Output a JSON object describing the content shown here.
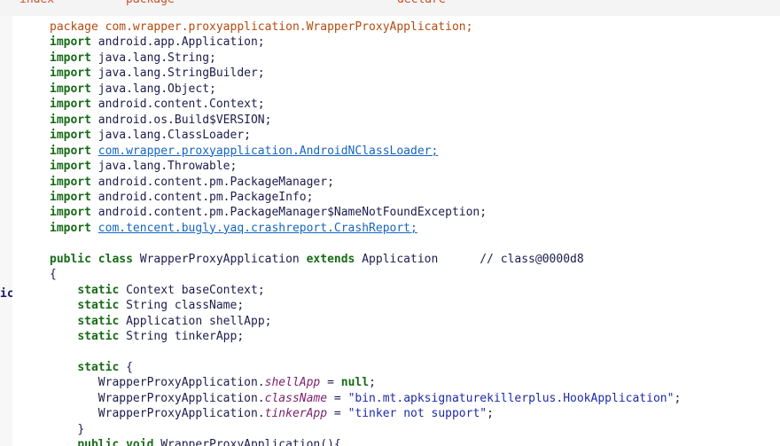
{
  "tabs": [
    "index",
    "package",
    "declare"
  ],
  "sidebar_mark": "ic",
  "lines": [
    {
      "indent": "",
      "parts": [
        {
          "t": "package ",
          "c": "pkg"
        },
        {
          "t": "com.wrapper.proxyapplication.WrapperProxyApplication;",
          "c": "pkg"
        }
      ]
    },
    {
      "indent": "",
      "parts": [
        {
          "t": "import",
          "c": "kw-g"
        },
        {
          "t": " android.app.Application;",
          "c": ""
        }
      ]
    },
    {
      "indent": "",
      "parts": [
        {
          "t": "import",
          "c": "kw-g"
        },
        {
          "t": " java.lang.String;",
          "c": ""
        }
      ]
    },
    {
      "indent": "",
      "parts": [
        {
          "t": "import",
          "c": "kw-g"
        },
        {
          "t": " java.lang.StringBuilder;",
          "c": ""
        }
      ]
    },
    {
      "indent": "",
      "parts": [
        {
          "t": "import",
          "c": "kw-g"
        },
        {
          "t": " java.lang.Object;",
          "c": ""
        }
      ]
    },
    {
      "indent": "",
      "parts": [
        {
          "t": "import",
          "c": "kw-g"
        },
        {
          "t": " android.content.Context;",
          "c": ""
        }
      ]
    },
    {
      "indent": "",
      "parts": [
        {
          "t": "import",
          "c": "kw-g"
        },
        {
          "t": " android.os.Build$VERSION;",
          "c": ""
        }
      ]
    },
    {
      "indent": "",
      "parts": [
        {
          "t": "import",
          "c": "kw-g"
        },
        {
          "t": " java.lang.ClassLoader;",
          "c": ""
        }
      ]
    },
    {
      "indent": "",
      "parts": [
        {
          "t": "import",
          "c": "kw-g"
        },
        {
          "t": " ",
          "c": ""
        },
        {
          "t": "com.wrapper.proxyapplication.AndroidNClassLoader;",
          "c": "link"
        }
      ]
    },
    {
      "indent": "",
      "parts": [
        {
          "t": "import",
          "c": "kw-g"
        },
        {
          "t": " java.lang.Throwable;",
          "c": ""
        }
      ]
    },
    {
      "indent": "",
      "parts": [
        {
          "t": "import",
          "c": "kw-g"
        },
        {
          "t": " android.content.pm.PackageManager;",
          "c": ""
        }
      ]
    },
    {
      "indent": "",
      "parts": [
        {
          "t": "import",
          "c": "kw-g"
        },
        {
          "t": " android.content.pm.PackageInfo;",
          "c": ""
        }
      ]
    },
    {
      "indent": "",
      "parts": [
        {
          "t": "import",
          "c": "kw-g"
        },
        {
          "t": " android.content.pm.PackageManager$NameNotFoundException;",
          "c": ""
        }
      ]
    },
    {
      "indent": "",
      "parts": [
        {
          "t": "import",
          "c": "kw-g"
        },
        {
          "t": " ",
          "c": ""
        },
        {
          "t": "com.tencent.bugly.yaq.crashreport.CrashReport;",
          "c": "link"
        }
      ]
    },
    {
      "indent": "",
      "parts": []
    },
    {
      "indent": "",
      "parts": [
        {
          "t": "public class",
          "c": "kw-g"
        },
        {
          "t": " WrapperProxyApplication ",
          "c": ""
        },
        {
          "t": "extends",
          "c": "kw-g"
        },
        {
          "t": " Application      // class@0000d8",
          "c": ""
        }
      ]
    },
    {
      "indent": "",
      "parts": [
        {
          "t": "{",
          "c": ""
        }
      ]
    },
    {
      "indent": "    ",
      "parts": [
        {
          "t": "static",
          "c": "kw-g"
        },
        {
          "t": " Context baseContext;",
          "c": ""
        }
      ]
    },
    {
      "indent": "    ",
      "parts": [
        {
          "t": "static",
          "c": "kw-g"
        },
        {
          "t": " String className;",
          "c": ""
        }
      ]
    },
    {
      "indent": "    ",
      "parts": [
        {
          "t": "static",
          "c": "kw-g"
        },
        {
          "t": " Application shellApp;",
          "c": ""
        }
      ]
    },
    {
      "indent": "    ",
      "parts": [
        {
          "t": "static",
          "c": "kw-g"
        },
        {
          "t": " String tinkerApp;",
          "c": ""
        }
      ]
    },
    {
      "indent": "",
      "parts": []
    },
    {
      "indent": "    ",
      "parts": [
        {
          "t": "static",
          "c": "kw-g"
        },
        {
          "t": " {",
          "c": ""
        }
      ]
    },
    {
      "indent": "       ",
      "parts": [
        {
          "t": "WrapperProxyApplication.",
          "c": ""
        },
        {
          "t": "shellApp",
          "c": "fld"
        },
        {
          "t": " = ",
          "c": ""
        },
        {
          "t": "null",
          "c": "kw-g"
        },
        {
          "t": ";",
          "c": ""
        }
      ]
    },
    {
      "indent": "       ",
      "parts": [
        {
          "t": "WrapperProxyApplication.",
          "c": ""
        },
        {
          "t": "className",
          "c": "fld"
        },
        {
          "t": " = ",
          "c": ""
        },
        {
          "t": "\"bin.mt.apksignaturekillerplus.HookApplication\"",
          "c": "str"
        },
        {
          "t": ";",
          "c": ""
        }
      ]
    },
    {
      "indent": "       ",
      "parts": [
        {
          "t": "WrapperProxyApplication.",
          "c": ""
        },
        {
          "t": "tinkerApp",
          "c": "fld"
        },
        {
          "t": " = ",
          "c": ""
        },
        {
          "t": "\"tinker not support\"",
          "c": "str"
        },
        {
          "t": ";",
          "c": ""
        }
      ]
    },
    {
      "indent": "    ",
      "parts": [
        {
          "t": "}",
          "c": ""
        }
      ]
    },
    {
      "indent": "    ",
      "parts": [
        {
          "t": "public void",
          "c": "kw-g"
        },
        {
          "t": " WrapperProxyApplication(){",
          "c": ""
        }
      ]
    }
  ]
}
